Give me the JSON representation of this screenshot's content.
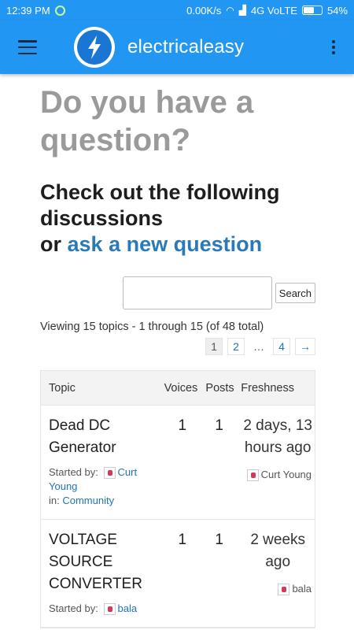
{
  "status": {
    "time": "12:39 PM",
    "speed": "0.00K/s",
    "network": "4G VoLTE",
    "battery": "54%",
    "bar_color": "#2196f3"
  },
  "appbar": {
    "title": "electricaleasy",
    "logo_icon": "lightning-bolt-icon"
  },
  "page": {
    "title": "Do you have a question?",
    "subhead_line1": "Check out the following discussions",
    "subhead_or": "or",
    "subhead_link": "ask a new question"
  },
  "search": {
    "placeholder": "",
    "button": "Search"
  },
  "viewing": "Viewing 15 topics - 1 through 15 (of 48 total)",
  "pagination": [
    "1",
    "2",
    "…",
    "4",
    "→"
  ],
  "forum": {
    "headers": {
      "topic": "Topic",
      "voices": "Voices",
      "posts": "Posts",
      "freshness": "Freshness"
    },
    "topics": [
      {
        "title": "Dead DC Generator",
        "started_by_label": "Started by:",
        "author": "Curt Young",
        "in_label": "in:",
        "forum": "Community",
        "voices": "1",
        "posts": "1",
        "freshness": "2 days, 13 hours ago",
        "last_author": "Curt Young"
      },
      {
        "title": "VOLTAGE SOURCE CONVERTER",
        "started_by_label": "Started by:",
        "author": "bala",
        "voices": "1",
        "posts": "1",
        "freshness": "2 weeks ago",
        "last_author": "bala"
      }
    ]
  }
}
